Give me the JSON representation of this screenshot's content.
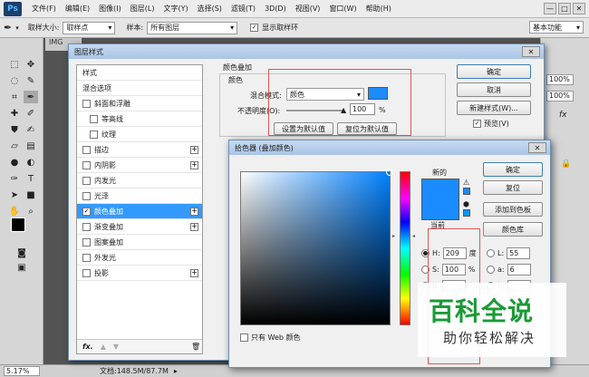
{
  "app": {
    "logo": "Ps",
    "menus": [
      "文件(F)",
      "编辑(E)",
      "图像(I)",
      "图层(L)",
      "文字(Y)",
      "选择(S)",
      "滤镜(T)",
      "3D(D)",
      "视图(V)",
      "窗口(W)",
      "帮助(H)"
    ],
    "window_controls": [
      "—",
      "□",
      "✕"
    ]
  },
  "options_bar": {
    "sample_size_label": "取样大小:",
    "sample_size_value": "取样点",
    "sample_label": "样本:",
    "sample_value": "所有图层",
    "show_ring_label": "显示取样环",
    "workspace": "基本功能"
  },
  "document": {
    "tab": "IMG",
    "zoom": "5.17%",
    "doc_info": "文档:148.5M/87.7M"
  },
  "right_panel": {
    "opacity_1": "100%",
    "opacity_2": "100%",
    "fx": "fx"
  },
  "layer_style": {
    "title": "图层样式",
    "styles_header": "样式",
    "blend_options": "混合选项",
    "items": [
      {
        "label": "斜面和浮雕",
        "checked": false,
        "plus": false,
        "indent": false
      },
      {
        "label": "等高线",
        "checked": false,
        "plus": false,
        "indent": true
      },
      {
        "label": "纹理",
        "checked": false,
        "plus": false,
        "indent": true
      },
      {
        "label": "描边",
        "checked": false,
        "plus": true,
        "indent": false
      },
      {
        "label": "内阴影",
        "checked": false,
        "plus": true,
        "indent": false
      },
      {
        "label": "内发光",
        "checked": false,
        "plus": false,
        "indent": false
      },
      {
        "label": "光泽",
        "checked": false,
        "plus": false,
        "indent": false
      },
      {
        "label": "颜色叠加",
        "checked": true,
        "plus": true,
        "indent": false,
        "selected": true
      },
      {
        "label": "渐变叠加",
        "checked": false,
        "plus": true,
        "indent": false
      },
      {
        "label": "图案叠加",
        "checked": false,
        "plus": false,
        "indent": false
      },
      {
        "label": "外发光",
        "checked": false,
        "plus": false,
        "indent": false
      },
      {
        "label": "投影",
        "checked": false,
        "plus": true,
        "indent": false
      }
    ],
    "footer_fx": "fx.",
    "overlay_title": "颜色叠加",
    "color_group": "颜色",
    "blend_mode_label": "混合模式:",
    "blend_mode_value": "颜色",
    "opacity_label": "不透明度(O):",
    "opacity_value": "100",
    "opacity_unit": "%",
    "make_default": "设置为默认值",
    "reset_default": "复位为默认值",
    "ok": "确定",
    "cancel": "取消",
    "new_style": "新建样式(W)...",
    "preview": "预览(V)",
    "overlay_color": "#1a8cff"
  },
  "color_picker": {
    "title": "拾色器 (叠加颜色)",
    "new_label": "新的",
    "current_label": "当前",
    "ok": "确定",
    "reset": "复位",
    "add_to_swatches": "添加到色板",
    "color_libraries": "颜色库",
    "web_only": "只有 Web 颜色",
    "new_color": "#1a8cff",
    "current_color": "#1a8cff",
    "h_label": "H:",
    "h_value": "209",
    "h_unit": "度",
    "s_label": "S:",
    "s_value": "100",
    "s_unit": "%",
    "b_label": "B:",
    "l_label": "L:",
    "l_value": "55",
    "a_label": "a:",
    "a_value": "6",
    "b2_label": "b:"
  },
  "watermark": {
    "main": "百科全说",
    "sub": "助你轻松解决"
  }
}
